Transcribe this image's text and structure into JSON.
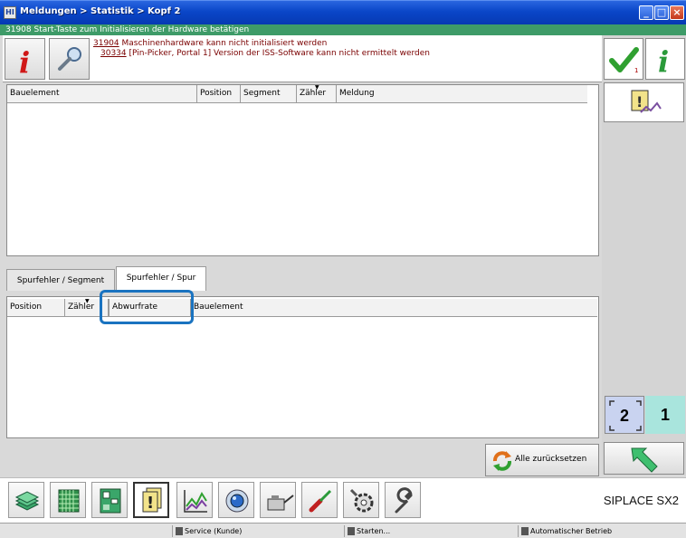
{
  "window": {
    "title": "Meldungen > Statistik > Kopf 2",
    "app_icon": "HI"
  },
  "status_line": "31908 Start-Taste zum Initialisieren der Hardware betätigen",
  "messages": [
    {
      "code": "31904",
      "text": " Maschinenhardware kann nicht initialisiert werden"
    },
    {
      "code": "30334",
      "text": " [Pin-Picker, Portal 1] Version der ISS-Software kann nicht ermittelt werden"
    }
  ],
  "ack_count": "1",
  "top_table": {
    "columns": [
      "Bauelement",
      "Position",
      "Segment",
      "Zähler",
      "Meldung"
    ]
  },
  "tabs": [
    {
      "label": "Spurfehler / Segment"
    },
    {
      "label": "Spurfehler / Spur"
    }
  ],
  "bottom_table": {
    "columns": [
      "Position",
      "Zähler",
      "Abwurfrate",
      "Bauelement"
    ]
  },
  "page_buttons": {
    "left": "2",
    "right": "1"
  },
  "reset_label": "Alle zurücksetzen",
  "product_name": "SIPLACE SX2",
  "statusbar": {
    "service": "Service (Kunde)",
    "start": "Starten...",
    "mode": "Automatischer Betrieb"
  },
  "colors": {
    "title_bar": "#0a46c8",
    "status_green": "#3e9b68",
    "message_text": "#7a0000",
    "highlight": "#1a73c0",
    "page_left_bg": "#c9d3f0",
    "page_right_bg": "#a9e5dd"
  }
}
